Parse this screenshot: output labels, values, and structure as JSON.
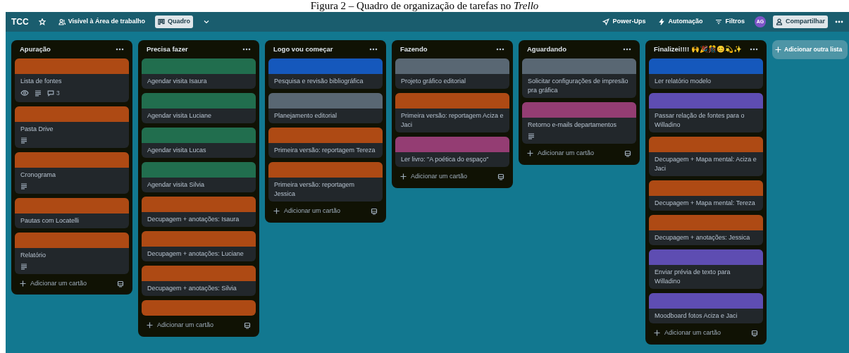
{
  "caption": "Figura 2 – Quadro de organização de tarefas no Trello",
  "topbar": {
    "board_name": "TCC",
    "starred": false,
    "visibility": "Visível à Área de trabalho",
    "views": [
      {
        "label": "Quadro",
        "selected": true
      }
    ],
    "actions": [
      {
        "kind": "powerups",
        "label": "Power-Ups"
      },
      {
        "kind": "automation",
        "label": "Automação"
      },
      {
        "kind": "filter",
        "label": "Filtros"
      }
    ],
    "avatar": "AG",
    "share": "Compartilhar"
  },
  "lists": [
    {
      "title": "Apuração",
      "cards": [
        {
          "color": "#ae4a14",
          "title": "Lista de fontes",
          "badges": [
            {
              "kind": "watch"
            },
            {
              "kind": "description"
            },
            {
              "kind": "comments",
              "text": "3"
            }
          ]
        },
        {
          "color": "#ae4a14",
          "title": "Pasta Drive",
          "badges": [
            {
              "kind": "description"
            }
          ]
        },
        {
          "color": "#ae4a14",
          "title": "Cronograma",
          "badges": [
            {
              "kind": "description"
            }
          ]
        },
        {
          "color": "#ae4a14",
          "title": "Pautas com Locatelli"
        },
        {
          "color": "#ae4a14",
          "title": "Relatório",
          "badges": [
            {
              "kind": "description"
            }
          ]
        }
      ],
      "add": "Adicionar um cartão"
    },
    {
      "title": "Precisa fazer",
      "cards": [
        {
          "color": "#216e4e",
          "title": "Agendar visita Isaura"
        },
        {
          "color": "#216e4e",
          "title": "Agendar visita Luciane"
        },
        {
          "color": "#216e4e",
          "title": "Agendar visita Lucas"
        },
        {
          "color": "#216e4e",
          "title": "Agendar visita Silvia"
        },
        {
          "color": "#ae4a14",
          "title": "Decupagem + anotações: Isaura"
        },
        {
          "color": "#ae4a14",
          "title": "Decupagem + anotações: Luciane"
        },
        {
          "color": "#ae4a14",
          "title": "Decupagem + anotações: Silvia"
        },
        {
          "color": "#ae4a14"
        }
      ],
      "add": "Adicionar um cartão"
    },
    {
      "title": "Logo vou começar",
      "cards": [
        {
          "color": "#1558bc",
          "title": "Pesquisa e revisão bibliográfica"
        },
        {
          "color": "#596773",
          "title": "Planejamento editorial"
        },
        {
          "color": "#ae4a14",
          "title": "Primeira versão: reportagem Tereza"
        },
        {
          "color": "#ae4a14",
          "title": "Primeira versão: reportagem Jessica"
        }
      ],
      "add": "Adicionar um cartão"
    },
    {
      "title": "Fazendo",
      "cards": [
        {
          "color": "#596773",
          "title": "Projeto gráfico editorial"
        },
        {
          "color": "#ae4a14",
          "title": "Primeira versão: reportagem Aciza e Jaci"
        },
        {
          "color": "#943d73",
          "title": "Ler livro: \"A poética do espaço\""
        }
      ],
      "add": "Adicionar um cartão"
    },
    {
      "title": "Aguardando",
      "cards": [
        {
          "color": "#596773",
          "title": "Solicitar configurações de impresão pra gráfica"
        },
        {
          "color": "#943d73",
          "title": "Retorno e-mails departamentos",
          "badges": [
            {
              "kind": "description"
            }
          ]
        }
      ],
      "add": "Adicionar um cartão"
    },
    {
      "title": "Finalizei!!!! 🙌🎉🎊😊💫✨",
      "cards": [
        {
          "color": "#1558bc",
          "title": "Ler relatório modelo"
        },
        {
          "color": "#5e4db2",
          "title": "Passar relação de fontes para o Willadino"
        },
        {
          "color": "#ae4a14",
          "title": "Decupagem + Mapa mental: Aciza e Jaci"
        },
        {
          "color": "#ae4a14",
          "title": "Decupagem + Mapa mental: Tereza"
        },
        {
          "color": "#ae4a14",
          "title": "Decupagem + anotações: Jessica"
        },
        {
          "color": "#5e4db2",
          "title": "Enviar prévia de texto para Willadino"
        },
        {
          "color": "#5e4db2",
          "title": "Moodboard fotos Aciza e Jaci"
        }
      ],
      "add": "Adicionar um cartão"
    }
  ],
  "add_list": "Adicionar outra lista"
}
